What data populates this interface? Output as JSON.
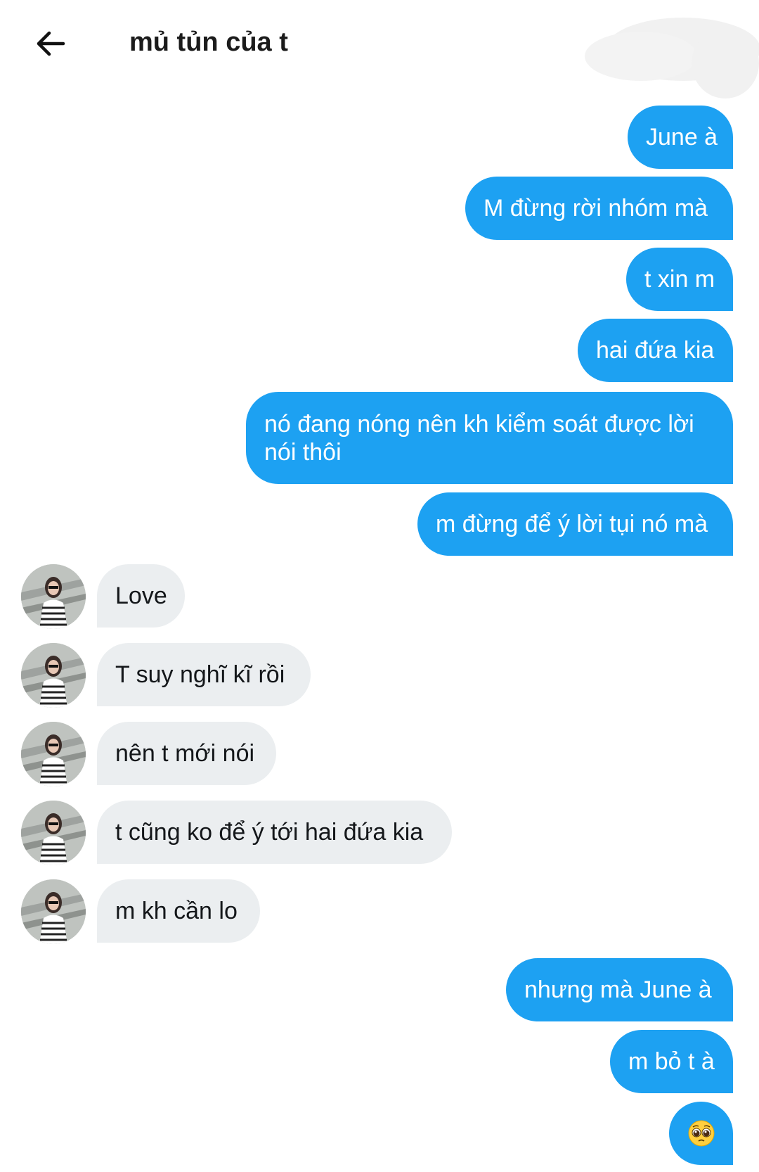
{
  "header": {
    "title": "mủ tủn của t",
    "back_icon": "arrow-left-icon"
  },
  "colors": {
    "outgoing": "#1da1f2",
    "incoming": "#ebeef0",
    "text_dark": "#14171a"
  },
  "messages": {
    "m1": "June à",
    "m2": "M đừng rời nhóm mà",
    "m3": "t xin m",
    "m4": "hai đứa kia",
    "m5": "nó đang nóng nên kh kiểm soát được lời nói thôi",
    "m6": "m đừng để ý lời tụi nó mà",
    "m7": "Love",
    "m8": "T suy nghĩ kĩ rồi",
    "m9": "nên t mới nói",
    "m10": "t cũng ko để ý tới hai đứa kia",
    "m11": "m kh cần lo",
    "m12": "nhưng mà June à",
    "m13": "m bỏ t à",
    "m14_emoji": "pleading-face-icon"
  }
}
